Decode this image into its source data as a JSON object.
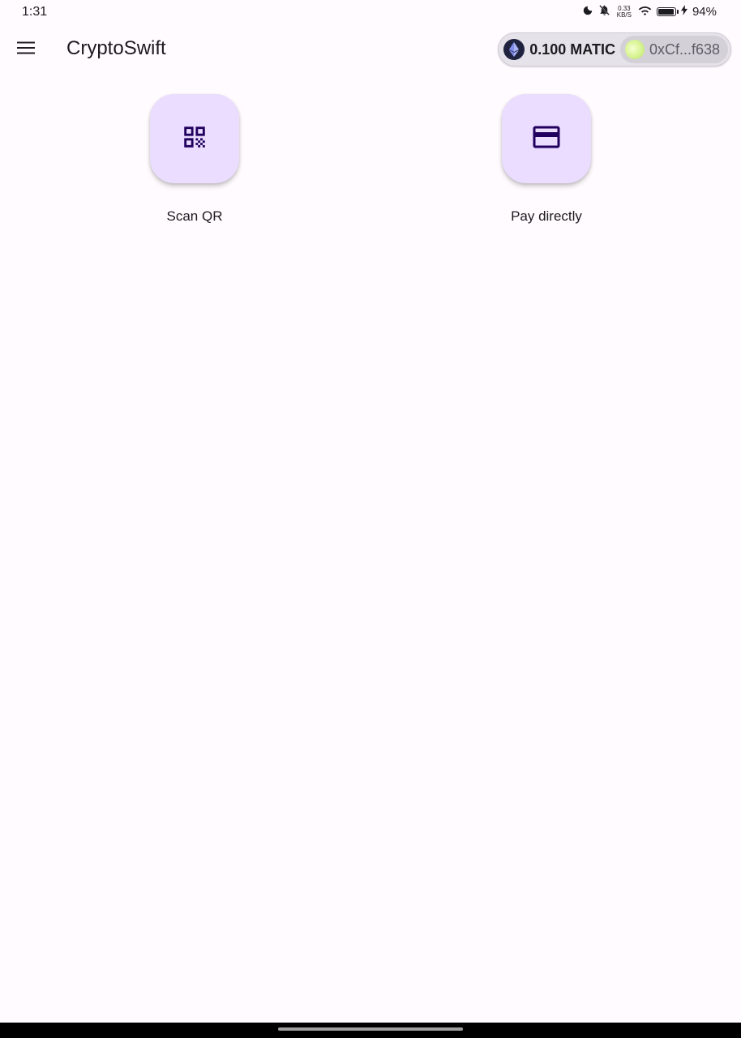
{
  "status_bar": {
    "time": "1:31",
    "net_speed_value": "0.33",
    "net_speed_unit": "KB/S",
    "battery_percent": "94%",
    "battery_level": 0.94,
    "icons": [
      "moon-icon",
      "bell-off-icon",
      "wifi-icon",
      "battery-icon",
      "charging-icon"
    ]
  },
  "app_bar": {
    "title": "CryptoSwift",
    "menu_icon": "hamburger-menu-icon"
  },
  "wallet": {
    "balance": "0.100 MATIC",
    "address": "0xCf...f638",
    "coin_icon": "ethereum-icon"
  },
  "actions": [
    {
      "label": "Scan QR",
      "icon": "qr-code-icon"
    },
    {
      "label": "Pay directly",
      "icon": "credit-card-icon"
    }
  ],
  "colors": {
    "background": "#fffbfe",
    "fab_background": "#eaddff",
    "icon_color": "#21005d",
    "pill_background": "#e6e2ea"
  }
}
